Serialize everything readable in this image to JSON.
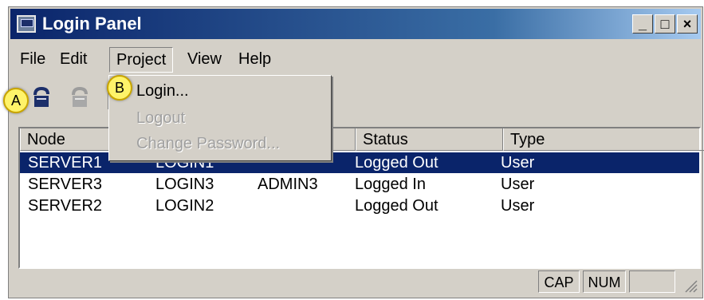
{
  "window": {
    "title": "Login Panel"
  },
  "caption_buttons": {
    "minimize": "_",
    "maximize": "□",
    "close": "×"
  },
  "menubar": {
    "items": [
      "File",
      "Edit",
      "Project",
      "View",
      "Help"
    ]
  },
  "dropdown": {
    "items": [
      {
        "label": "Login...",
        "enabled": true
      },
      {
        "label": "Logout",
        "enabled": false
      },
      {
        "label": "Change Password...",
        "enabled": false
      }
    ]
  },
  "callouts": {
    "a": "A",
    "b": "B"
  },
  "table": {
    "columns": [
      "Node",
      "",
      "",
      "Status",
      "Type"
    ],
    "rows": [
      {
        "node": "SERVER1",
        "login": "LOGIN1",
        "user": "",
        "status": "Logged Out",
        "type": "User",
        "selected": true
      },
      {
        "node": "SERVER3",
        "login": "LOGIN3",
        "user": "ADMIN3",
        "status": "Logged In",
        "type": "User",
        "selected": false
      },
      {
        "node": "SERVER2",
        "login": "LOGIN2",
        "user": "",
        "status": "Logged Out",
        "type": "User",
        "selected": false
      }
    ]
  },
  "statusbar": {
    "cap": "CAP",
    "num": "NUM",
    "scrl": ""
  },
  "colors": {
    "title_gradient_start": "#0a246a",
    "selection": "#0a246a",
    "callout": "#fff36a"
  },
  "icons": [
    "login-icon",
    "logout-icon",
    "app-icon",
    "resize-grip-icon"
  ]
}
